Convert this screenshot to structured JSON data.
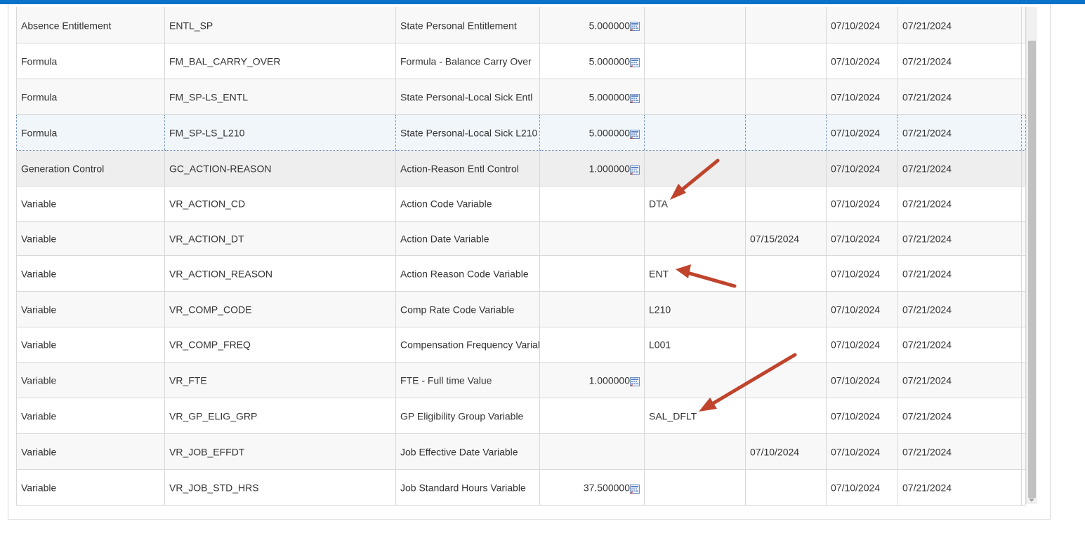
{
  "colors": {
    "accent_bar": "#0a72c9",
    "annotation_arrow": "#c0442c"
  },
  "grid": {
    "rows": [
      {
        "type": "Absence Entitlement",
        "name": "ENTL_SP",
        "description": "State Personal Entitlement",
        "number": "5.000000",
        "has_icon": true,
        "character": "",
        "date": "",
        "begin": "07/10/2024",
        "end": "07/21/2024"
      },
      {
        "type": "Formula",
        "name": "FM_BAL_CARRY_OVER",
        "description": "Formula - Balance Carry Over",
        "number": "5.000000",
        "has_icon": true,
        "character": "",
        "date": "",
        "begin": "07/10/2024",
        "end": "07/21/2024"
      },
      {
        "type": "Formula",
        "name": "FM_SP-LS_ENTL",
        "description": "State Personal-Local Sick Entl",
        "number": "5.000000",
        "has_icon": true,
        "character": "",
        "date": "",
        "begin": "07/10/2024",
        "end": "07/21/2024"
      },
      {
        "type": "Formula",
        "name": "FM_SP-LS_L210",
        "description": "State Personal-Local Sick L210",
        "number": "5.000000",
        "has_icon": true,
        "character": "",
        "date": "",
        "begin": "07/10/2024",
        "end": "07/21/2024"
      },
      {
        "type": "Generation Control",
        "name": "GC_ACTION-REASON",
        "description": "Action-Reason Entl Control",
        "number": "1.000000",
        "has_icon": true,
        "character": "",
        "date": "",
        "begin": "07/10/2024",
        "end": "07/21/2024"
      },
      {
        "type": "Variable",
        "name": "VR_ACTION_CD",
        "description": "Action Code Variable",
        "number": "",
        "has_icon": false,
        "character": "DTA",
        "date": "",
        "begin": "07/10/2024",
        "end": "07/21/2024"
      },
      {
        "type": "Variable",
        "name": "VR_ACTION_DT",
        "description": "Action Date Variable",
        "number": "",
        "has_icon": false,
        "character": "",
        "date": "07/15/2024",
        "begin": "07/10/2024",
        "end": "07/21/2024"
      },
      {
        "type": "Variable",
        "name": "VR_ACTION_REASON",
        "description": "Action Reason Code Variable",
        "number": "",
        "has_icon": false,
        "character": "ENT",
        "date": "",
        "begin": "07/10/2024",
        "end": "07/21/2024"
      },
      {
        "type": "Variable",
        "name": "VR_COMP_CODE",
        "description": "Comp Rate Code Variable",
        "number": "",
        "has_icon": false,
        "character": "L210",
        "date": "",
        "begin": "07/10/2024",
        "end": "07/21/2024"
      },
      {
        "type": "Variable",
        "name": "VR_COMP_FREQ",
        "description": "Compensation Frequency Variabl",
        "number": "",
        "has_icon": false,
        "character": "L001",
        "date": "",
        "begin": "07/10/2024",
        "end": "07/21/2024"
      },
      {
        "type": "Variable",
        "name": "VR_FTE",
        "description": "FTE - Full time Value",
        "number": "1.000000",
        "has_icon": true,
        "character": "",
        "date": "",
        "begin": "07/10/2024",
        "end": "07/21/2024"
      },
      {
        "type": "Variable",
        "name": "VR_GP_ELIG_GRP",
        "description": "GP Eligibility Group Variable",
        "number": "",
        "has_icon": false,
        "character": "SAL_DFLT",
        "date": "",
        "begin": "07/10/2024",
        "end": "07/21/2024"
      },
      {
        "type": "Variable",
        "name": "VR_JOB_EFFDT",
        "description": "Job Effective Date Variable",
        "number": "",
        "has_icon": false,
        "character": "",
        "date": "07/10/2024",
        "begin": "07/10/2024",
        "end": "07/21/2024"
      },
      {
        "type": "Variable",
        "name": "VR_JOB_STD_HRS",
        "description": "Job Standard Hours Variable",
        "number": "37.500000",
        "has_icon": true,
        "character": "",
        "date": "",
        "begin": "07/10/2024",
        "end": "07/21/2024"
      }
    ]
  }
}
